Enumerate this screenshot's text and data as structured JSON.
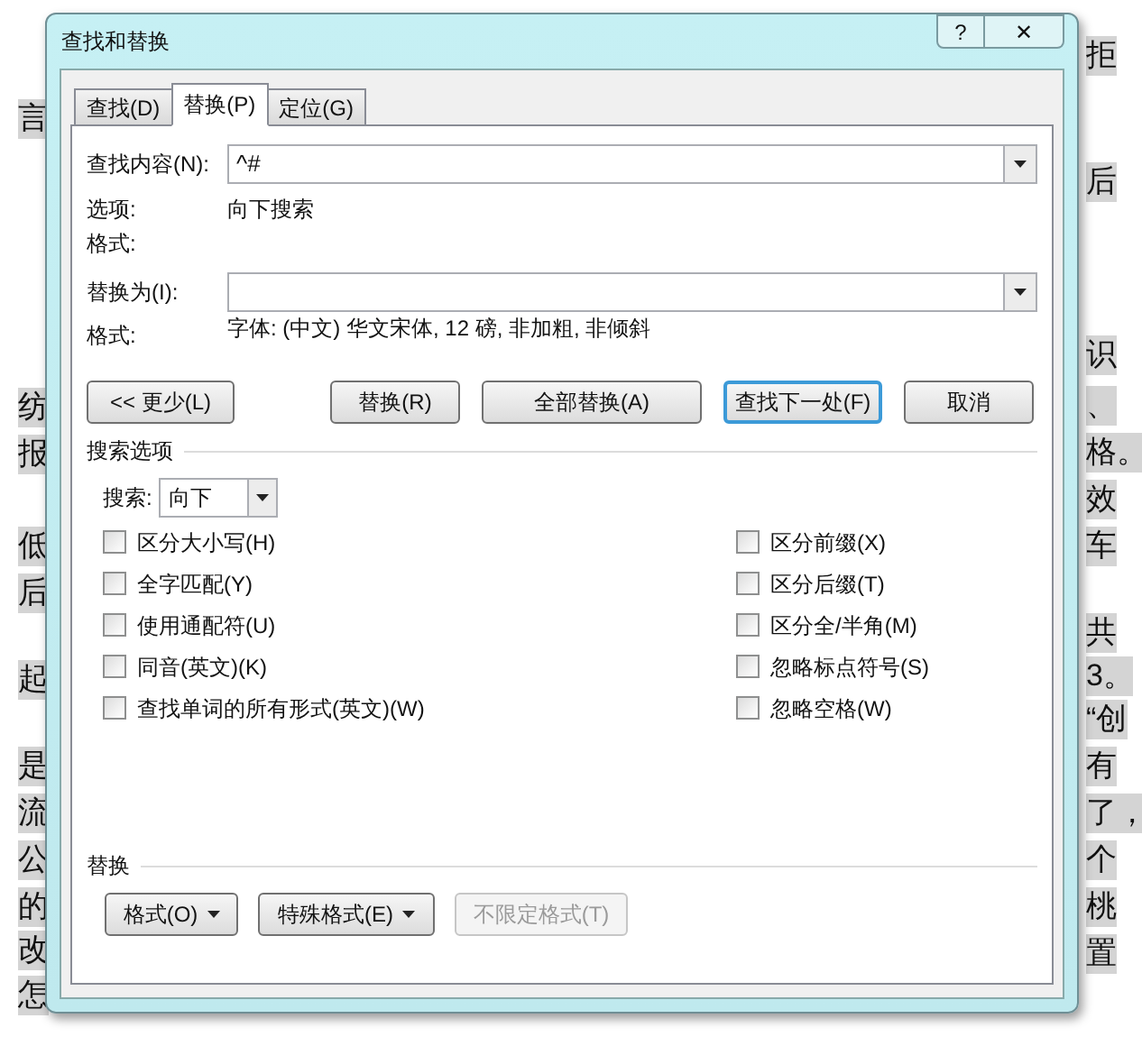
{
  "background": {
    "left_lines": [
      "言",
      "纺",
      "报",
      "低",
      "后",
      "起",
      "是",
      "流",
      "公",
      "的",
      "改",
      "怎"
    ],
    "right_lines": [
      "拒",
      "后",
      "识",
      "、",
      "格。",
      "效",
      "车",
      "共",
      "3。",
      "“创",
      "有",
      "了，",
      "个",
      "桃",
      "置"
    ]
  },
  "window": {
    "title": "查找和替换",
    "help": "?",
    "close": "✕"
  },
  "tabs": [
    {
      "label": "查找(D)",
      "selected": false
    },
    {
      "label": "替换(P)",
      "selected": true
    },
    {
      "label": "定位(G)",
      "selected": false
    }
  ],
  "find": {
    "label": "查找内容(N):",
    "value": "^#",
    "options_label": "选项:",
    "options_value": "向下搜索",
    "format_label": "格式:"
  },
  "replace": {
    "label": "替换为(I):",
    "format_label": "格式:",
    "format_value": "字体: (中文) 华文宋体, 12 磅, 非加粗, 非倾斜"
  },
  "buttons": [
    {
      "label": "<< 更少(L)",
      "focused": false
    },
    {
      "label": "替换(R)",
      "focused": false
    },
    {
      "label": "全部替换(A)",
      "focused": false
    },
    {
      "label": "查找下一处(F)",
      "focused": true
    },
    {
      "label": "取消",
      "focused": false
    }
  ],
  "search_options": {
    "title": "搜索选项",
    "search_label": "搜索:",
    "search_value": "向下",
    "left": [
      {
        "label": "区分大小写(H)",
        "checked": false
      },
      {
        "label": "全字匹配(Y)",
        "checked": false
      },
      {
        "label": "使用通配符(U)",
        "checked": false
      },
      {
        "label": "同音(英文)(K)",
        "checked": false
      },
      {
        "label": "查找单词的所有形式(英文)(W)",
        "checked": false
      }
    ],
    "right": [
      {
        "label": "区分前缀(X)",
        "checked": false
      },
      {
        "label": "区分后缀(T)",
        "checked": false
      },
      {
        "label": "区分全/半角(M)",
        "checked": false
      },
      {
        "label": "忽略标点符号(S)",
        "checked": false
      },
      {
        "label": "忽略空格(W)",
        "checked": false
      }
    ]
  },
  "replace_section": {
    "title": "替换",
    "buttons": [
      {
        "label": "格式(O)",
        "menu": true,
        "disabled": false
      },
      {
        "label": "特殊格式(E)",
        "menu": true,
        "disabled": false
      },
      {
        "label": "不限定格式(T)",
        "menu": false,
        "disabled": true
      }
    ]
  }
}
